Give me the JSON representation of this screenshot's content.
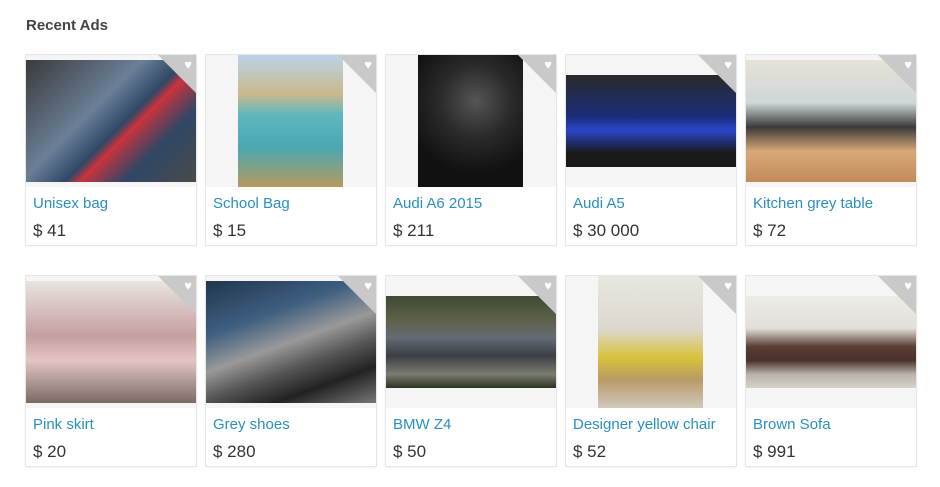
{
  "section_title": "Recent Ads",
  "favorite_icon": "heart-icon",
  "ads": [
    {
      "title": "Unisex bag",
      "price": "$ 41",
      "image": "bag photo"
    },
    {
      "title": "School Bag",
      "price": "$ 15",
      "image": "backpack photo"
    },
    {
      "title": "Audi A6 2015",
      "price": "$ 211",
      "image": "car interior photo"
    },
    {
      "title": "Audi A5",
      "price": "$ 30 000",
      "image": "blue car photo"
    },
    {
      "title": "Kitchen grey table",
      "price": "$ 72",
      "image": "table photo"
    },
    {
      "title": "Pink skirt",
      "price": "$ 20",
      "image": "skirt photo"
    },
    {
      "title": "Grey shoes",
      "price": "$ 280",
      "image": "shoes photo"
    },
    {
      "title": "BMW Z4",
      "price": "$ 50",
      "image": "grey car photo"
    },
    {
      "title": "Designer yellow chair",
      "price": "$ 52",
      "image": "chair photo"
    },
    {
      "title": "Brown Sofa",
      "price": "$ 991",
      "image": "sofa photo"
    }
  ]
}
